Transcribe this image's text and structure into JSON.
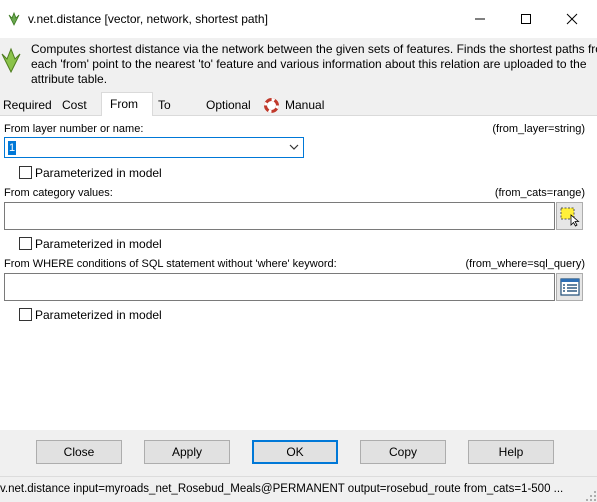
{
  "window": {
    "title": "v.net.distance [vector, network, shortest path]",
    "accent_color": "#0078d7"
  },
  "description": {
    "line1": "Computes shortest distance via the network between the given sets of features. Finds the shortest paths from",
    "line2": "each 'from' point to the nearest 'to' feature and various information about this relation are uploaded to the",
    "line3": "attribute table."
  },
  "tabs": [
    {
      "label": "Required"
    },
    {
      "label": "Cost"
    },
    {
      "label": "From",
      "active": true
    },
    {
      "label": "To"
    },
    {
      "label": "Optional"
    },
    {
      "label": "Manual",
      "icon": "lifebuoy-icon"
    }
  ],
  "from_layer": {
    "label": "From layer number or name:",
    "key": "(from_layer=string)",
    "value": "1",
    "parameterized_label": "Parameterized in model"
  },
  "from_cats": {
    "label": "From category values:",
    "key": "(from_cats=range)",
    "value": "",
    "parameterized_label": "Parameterized in model",
    "side_icon": "select-features-icon"
  },
  "from_where": {
    "label": "From WHERE conditions of SQL statement without 'where' keyword:",
    "key": "(from_where=sql_query)",
    "value": "",
    "parameterized_label": "Parameterized in model",
    "side_icon": "sql-builder-icon"
  },
  "buttons": {
    "close": "Close",
    "apply": "Apply",
    "ok": "OK",
    "copy": "Copy",
    "help": "Help"
  },
  "status": {
    "command": "v.net.distance input=myroads_net_Rosebud_Meals@PERMANENT output=rosebud_route from_cats=1-500 ..."
  }
}
